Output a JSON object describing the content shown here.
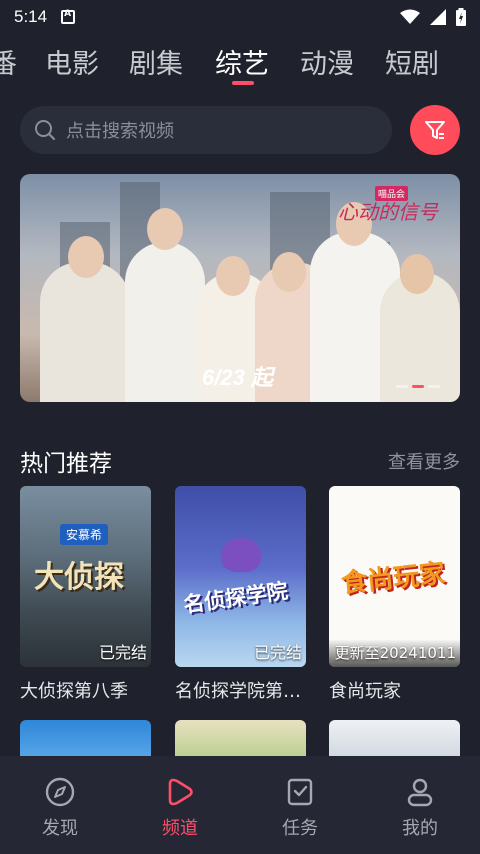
{
  "status_bar": {
    "time": "5:14"
  },
  "tabs": [
    {
      "label": "番",
      "active": false
    },
    {
      "label": "电影",
      "active": false
    },
    {
      "label": "剧集",
      "active": false
    },
    {
      "label": "综艺",
      "active": true
    },
    {
      "label": "动漫",
      "active": false
    },
    {
      "label": "短剧",
      "active": false
    }
  ],
  "search": {
    "placeholder": "点击搜索视频"
  },
  "banner": {
    "date_text": "6/23 起",
    "logo_badge": "喵品会",
    "logo_text": "心动的信号"
  },
  "section": {
    "title": "热门推荐",
    "see_more": "查看更多"
  },
  "cards": [
    {
      "title": "大侦探第八季",
      "badge": "已完结",
      "poster_text": "大侦探",
      "poster_sub": "安慕希"
    },
    {
      "title": "名侦探学院第…",
      "badge": "已完结",
      "poster_text": "名侦探学院"
    },
    {
      "title": "食尚玩家",
      "badge": "更新至20241011",
      "poster_text": "食尚玩家"
    }
  ],
  "bottom_nav": [
    {
      "label": "发现",
      "icon": "compass-icon",
      "active": false
    },
    {
      "label": "频道",
      "icon": "play-icon",
      "active": true
    },
    {
      "label": "任务",
      "icon": "task-icon",
      "active": false
    },
    {
      "label": "我的",
      "icon": "user-icon",
      "active": false
    }
  ],
  "colors": {
    "accent": "#ff4d6a",
    "background": "#1f222c"
  }
}
